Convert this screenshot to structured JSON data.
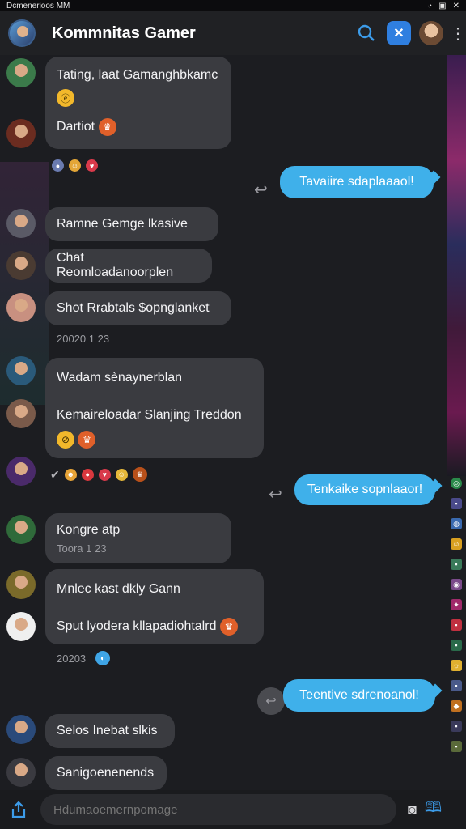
{
  "status_bar": {
    "carrier": "Dcmenerioos  MM",
    "icons": [
      "wifi-icon",
      "battery-icon",
      "close-icon"
    ]
  },
  "header": {
    "title": "Kommnitas Gamer"
  },
  "messages": [
    {
      "type": "incoming",
      "lines": [
        "Tating, laat Gamanghbkamc",
        "",
        "Dartiot"
      ]
    },
    {
      "type": "outgoing",
      "text": "Tavaiire sdaplaaaol!"
    },
    {
      "type": "incoming",
      "lines": [
        "Ramne Gemge lkasive"
      ]
    },
    {
      "type": "incoming",
      "lines": [
        "Chat Reomloadanoorplen"
      ]
    },
    {
      "type": "incoming",
      "lines": [
        "Shot Rrabtals $opnglanket"
      ],
      "timestamp": "20020  1 23"
    },
    {
      "type": "incoming",
      "lines": [
        "Wadam sènaynerblan",
        "Kemaireloadar Slanjing Treddon"
      ]
    },
    {
      "type": "outgoing",
      "text": "Tenkaike sopnlaaor!"
    },
    {
      "type": "incoming",
      "lines": [
        "Kongre atp"
      ],
      "timestamp": "Toora 1 23"
    },
    {
      "type": "incoming",
      "lines": [
        "Mnlec kast dkly Gann",
        "Sput lyodera kllapadiohtalrd"
      ],
      "timestamp": "20203"
    },
    {
      "type": "outgoing",
      "text": "Teentive sdrenoanol!"
    },
    {
      "type": "incoming",
      "lines": [
        "Selos Inebat slkis"
      ]
    },
    {
      "type": "incoming",
      "lines": [
        "Sanigoenenends"
      ]
    }
  ],
  "composer": {
    "placeholder": "Hdumaoemernpomage"
  },
  "colors": {
    "accent": "#3fb0ea",
    "bubble_in": "#3a3b40",
    "background": "#1c1d21",
    "brand_blue": "#2f7fe0"
  }
}
